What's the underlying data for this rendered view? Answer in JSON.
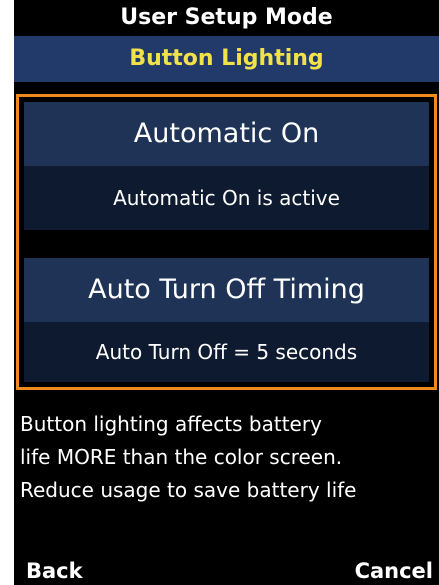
{
  "header": {
    "title": "User Setup Mode",
    "subtitle": "Button Lighting"
  },
  "options": [
    {
      "label": "Automatic On",
      "value": "Automatic On is active"
    },
    {
      "label": "Auto Turn Off Timing",
      "value": "Auto Turn Off = 5 seconds"
    }
  ],
  "info": {
    "lines": [
      "Button lighting affects battery",
      "life MORE than the color screen.",
      "Reduce usage to save battery life"
    ]
  },
  "softkeys": {
    "left": "Back",
    "right": "Cancel"
  },
  "colors": {
    "subtitle_bg": "#223a69",
    "subtitle_text": "#f2e24a",
    "selection_border": "#f08a1c",
    "option_header_bg": "#1e3356",
    "option_value_bg": "#0d1a2f"
  }
}
